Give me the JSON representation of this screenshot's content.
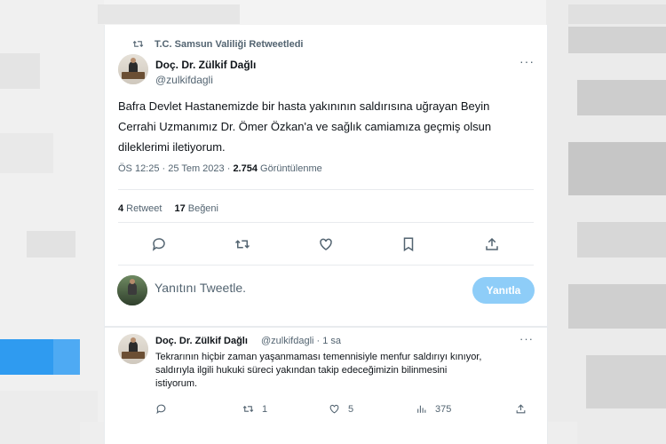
{
  "retweet_context": {
    "label": "T.C. Samsun Valiliği Retweetledi"
  },
  "tweet": {
    "author_name": "Doç. Dr. Zülkif Dağlı",
    "author_handle": "@zulkifdagli",
    "body_lines": [
      "Bafra Devlet Hastanemizde bir hasta yakınının saldırısına uğrayan Beyin",
      "Cerrahi Uzmanımız Dr. Ömer Özkan'a ve sağlık camiamıza geçmiş olsun",
      "dileklerimi iletiyorum."
    ],
    "timestamp": "ÖS 12:25 · 25 Tem 2023 ·",
    "views_count": "2.754",
    "views_label": "Görüntülenme",
    "retweet_count": "4",
    "retweet_label": "Retweet",
    "like_count": "17",
    "like_label": "Beğeni"
  },
  "reply_composer": {
    "placeholder": "Yanıtını Tweetle.",
    "button_label": "Yanıtla"
  },
  "reply": {
    "author_name": "Doç. Dr. Zülkif Dağlı",
    "author_handle": "@zulkifdagli · 1 sa",
    "body_lines": [
      "Tekrarının hiçbir zaman yaşanmaması temennisiyle menfur saldırıyı kınıyor,",
      "saldırıyla ilgili hukuki süreci yakından takip edeceğimizin bilinmesini",
      "istiyorum."
    ],
    "retweet_count": "1",
    "like_count": "5",
    "views_count": "375"
  },
  "colors": {
    "accent_disabled": "#8ecdf8",
    "secondary_text": "#536471",
    "primary_text": "#0f1419"
  },
  "icons": [
    "retweet-icon",
    "more-icon",
    "reply-icon",
    "like-icon",
    "bookmark-icon",
    "share-icon",
    "views-icon"
  ]
}
